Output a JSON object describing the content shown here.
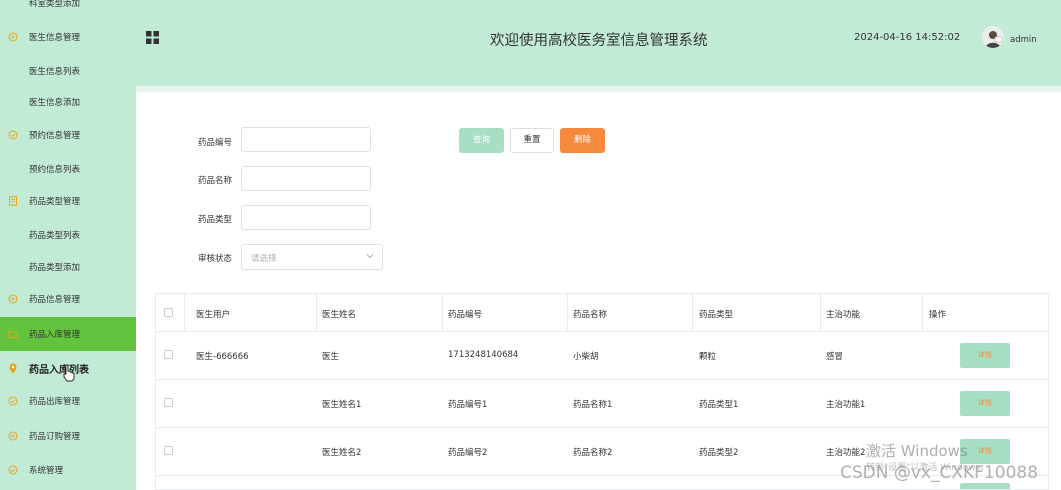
{
  "sidebar": {
    "items": [
      {
        "label": "科室类型添加",
        "icon": "none"
      },
      {
        "label": "医生信息管理",
        "icon": "chat-icon"
      },
      {
        "label": "医生信息列表",
        "icon": "none"
      },
      {
        "label": "医生信息添加",
        "icon": "none"
      },
      {
        "label": "预约信息管理",
        "icon": "check-circle-icon"
      },
      {
        "label": "预约信息列表",
        "icon": "none"
      },
      {
        "label": "药品类型管理",
        "icon": "document-icon"
      },
      {
        "label": "药品类型列表",
        "icon": "none"
      },
      {
        "label": "药品类型添加",
        "icon": "none"
      },
      {
        "label": "药品信息管理",
        "icon": "chat-icon"
      },
      {
        "label": "药品入库管理",
        "icon": "folder-icon"
      },
      {
        "label": "药品入库列表",
        "icon": "map-pin-icon"
      },
      {
        "label": "药品出库管理",
        "icon": "check-circle-icon"
      },
      {
        "label": "药品订购管理",
        "icon": "chat-icon"
      },
      {
        "label": "系统管理",
        "icon": "check-circle-icon"
      }
    ],
    "active_color": "#63c33e",
    "bg_color": "#c2ebd6"
  },
  "header": {
    "title": "欢迎使用高校医务室信息管理系统",
    "datetime": "2024-04-16 14:52:02",
    "username": "admin"
  },
  "search": {
    "drug_code_label": "药品编号",
    "drug_name_label": "药品名称",
    "drug_type_label": "药品类型",
    "review_status_label": "审核状态",
    "review_status_placeholder": "请选择",
    "query_label": "查询",
    "reset_label": "重置",
    "delete_label": "删除"
  },
  "table": {
    "columns": [
      "医生用户",
      "医生姓名",
      "药品编号",
      "药品名称",
      "药品类型",
      "主治功能",
      "操作"
    ],
    "rows": [
      {
        "doctor_user": "医生-666666",
        "doctor_name": "医生",
        "drug_code": "1713248140684",
        "drug_name": "小柴胡",
        "drug_type": "颗粒",
        "function": "感冒",
        "action": "详情"
      },
      {
        "doctor_user": "",
        "doctor_name": "医生姓名1",
        "drug_code": "药品编号1",
        "drug_name": "药品名称1",
        "drug_type": "药品类型1",
        "function": "主治功能1",
        "action": "详情"
      },
      {
        "doctor_user": "",
        "doctor_name": "医生姓名2",
        "drug_code": "药品编号2",
        "drug_name": "药品名称2",
        "drug_type": "药品类型2",
        "function": "主治功能2",
        "action": "详情"
      }
    ]
  },
  "watermark": {
    "activate_windows": "激活 Windows",
    "activate_sub": "转到\"设置\"以激活 Windows。",
    "csdn": "CSDN @vx_CXKF10088"
  }
}
